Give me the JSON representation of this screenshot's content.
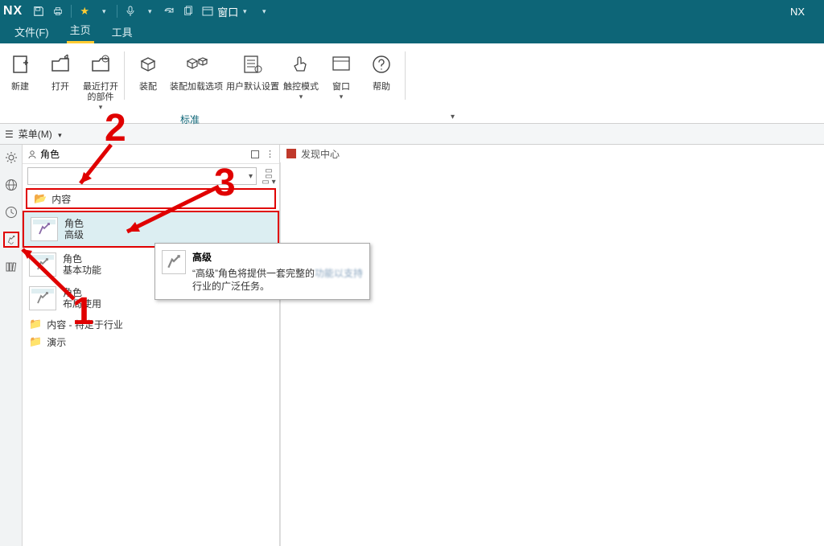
{
  "title_bar": {
    "logo": "NX",
    "window_menu_label": "窗口",
    "app_name": "NX"
  },
  "menu": {
    "file": "文件(F)",
    "home": "主页",
    "tools": "工具"
  },
  "ribbon": {
    "new": "新建",
    "open": "打开",
    "recent": "最近打开\n的部件",
    "assemble": "装配",
    "assemble_load_options": "装配加载选项",
    "user_defaults": "用户默认设置",
    "touch_mode": "触控模式",
    "window": "窗口",
    "help": "帮助",
    "sub_label": "标准"
  },
  "secondary": {
    "menu_label": "菜单(M)"
  },
  "side_panel": {
    "title": "角色",
    "folder_content": "内容",
    "roles": [
      {
        "label_line1": "角色",
        "label_line2": "高级"
      },
      {
        "label_line1": "角色",
        "label_line2": "基本功能"
      },
      {
        "label_line1": "角色",
        "label_line2": "布局使用"
      }
    ],
    "folder_industry": "内容 - 特定于行业",
    "folder_demo": "演示"
  },
  "tooltip": {
    "title": "高级",
    "body_1": "“高级”角色将提供一套完整的",
    "body_blur": "功能以支持",
    "body_2": "行业的广泛任务。"
  },
  "content_tab": {
    "label": "发现中心"
  },
  "annotations": {
    "n1": "1",
    "n2": "2",
    "n3": "3"
  }
}
